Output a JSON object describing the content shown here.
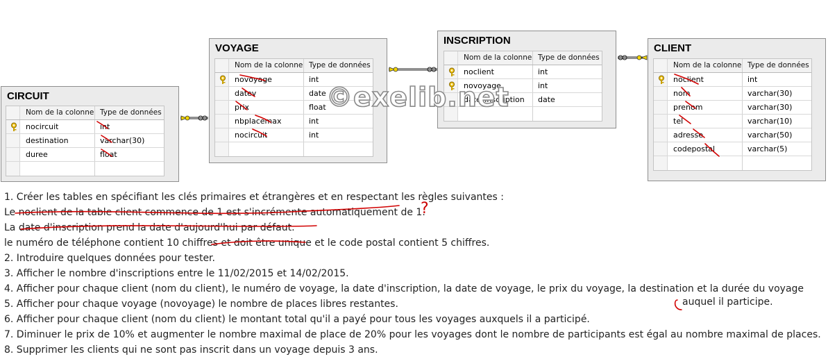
{
  "columns_header": {
    "name": "Nom de la colonne",
    "type": "Type de données"
  },
  "tables": {
    "circuit": {
      "title": "CIRCUIT",
      "rows": [
        {
          "name": "nocircuit",
          "type": "int",
          "pk": true
        },
        {
          "name": "destination",
          "type": "varchar(30)",
          "pk": false
        },
        {
          "name": "duree",
          "type": "float",
          "pk": false
        }
      ]
    },
    "voyage": {
      "title": "VOYAGE",
      "rows": [
        {
          "name": "novoyage",
          "type": "int",
          "pk": true
        },
        {
          "name": "datev",
          "type": "date",
          "pk": false
        },
        {
          "name": "prix",
          "type": "float",
          "pk": false
        },
        {
          "name": "nbplacemax",
          "type": "int",
          "pk": false
        },
        {
          "name": "nocircuit",
          "type": "int",
          "pk": false
        }
      ]
    },
    "inscription": {
      "title": "INSCRIPTION",
      "rows": [
        {
          "name": "noclient",
          "type": "int",
          "pk": true
        },
        {
          "name": "novoyage",
          "type": "int",
          "pk": true
        },
        {
          "name": "date_inscription",
          "type": "date",
          "pk": false
        }
      ]
    },
    "client": {
      "title": "CLIENT",
      "rows": [
        {
          "name": "noclient",
          "type": "int",
          "pk": true
        },
        {
          "name": "nom",
          "type": "varchar(30)",
          "pk": false
        },
        {
          "name": "prenom",
          "type": "varchar(30)",
          "pk": false
        },
        {
          "name": "tel",
          "type": "varchar(10)",
          "pk": false
        },
        {
          "name": "adresse",
          "type": "varchar(50)",
          "pk": false
        },
        {
          "name": "codepostal",
          "type": "varchar(5)",
          "pk": false
        }
      ]
    }
  },
  "watermark": "©exelib.net",
  "instructions": [
    "1. Créer les tables en spécifiant les clés primaires et étrangères et en respectant les règles suivantes :",
    "Le noclient de la table client commence de 1 est s'incrémente automatiquement de 1.",
    "La date d'inscription prend la date d'aujourd'hui par défaut.",
    "le numéro de téléphone contient 10 chiffres et doit être unique et le code postal contient 5 chiffres.",
    "2. Introduire quelques données pour tester.",
    "3. Afficher le nombre d'inscriptions entre le 11/02/2015 et 14/02/2015.",
    "4. Afficher pour chaque client (nom du client), le numéro de voyage, la date d'inscription, la date de voyage, le prix du voyage, la destination et la durée du voyage",
    "5. Afficher pour chaque voyage (novoyage) le nombre de places libres restantes.",
    "6. Afficher pour chaque client (nom du client) le montant total qu'il a payé pour tous les voyages auxquels il a participé.",
    "7. Diminuer le prix de 10% et augmenter le nombre maximal de place de 20% pour les voyages dont le nombre de participants est égal au nombre maximal de places.",
    "8. Supprimer les clients qui ne sont pas inscrit dans un voyage depuis 3 ans."
  ],
  "overflow_note": "auquel il participe.",
  "annotation_mark": "?"
}
